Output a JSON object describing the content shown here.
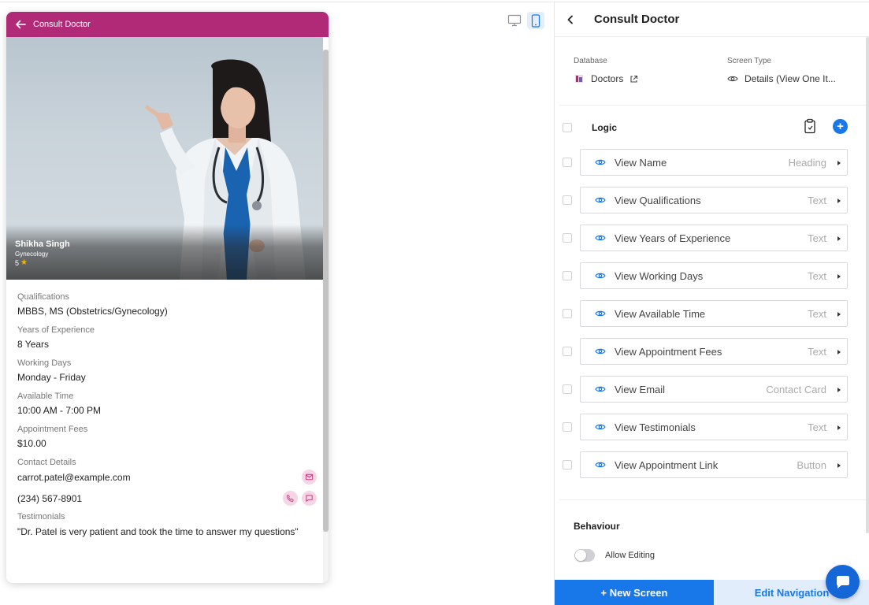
{
  "preview": {
    "header_title": "Consult Doctor",
    "doctor": {
      "name": "Shikha Singh",
      "specialty": "Gynecology",
      "rating": "5"
    },
    "fields": [
      {
        "label": "Qualifications",
        "value": "MBBS, MS (Obstetrics/Gynecology)"
      },
      {
        "label": "Years of Experience",
        "value": "8 Years"
      },
      {
        "label": "Working Days",
        "value": "Monday - Friday"
      },
      {
        "label": "Available Time",
        "value": "10:00 AM - 7:00 PM"
      },
      {
        "label": "Appointment Fees",
        "value": "$10.00"
      }
    ],
    "contact": {
      "label": "Contact Details",
      "email": "carrot.patel@example.com",
      "phone": "(234) 567-8901"
    },
    "testimonials": {
      "label": "Testimonials",
      "text": "\"Dr. Patel is very patient and took the time to answer my questions\""
    },
    "accent_color": "#b12a78"
  },
  "panel": {
    "title": "Consult Doctor",
    "database_label": "Database",
    "database_value": "Doctors",
    "screen_type_label": "Screen Type",
    "screen_type_value": "Details (View One It...",
    "logic_label": "Logic",
    "components": [
      {
        "name": "View Name",
        "type": "Heading"
      },
      {
        "name": "View Qualifications",
        "type": "Text"
      },
      {
        "name": "View Years of Experience",
        "type": "Text"
      },
      {
        "name": "View Working Days",
        "type": "Text"
      },
      {
        "name": "View Available Time",
        "type": "Text"
      },
      {
        "name": "View Appointment Fees",
        "type": "Text"
      },
      {
        "name": "View Email",
        "type": "Contact Card"
      },
      {
        "name": "View Testimonials",
        "type": "Text"
      },
      {
        "name": "View Appointment Link",
        "type": "Button"
      }
    ],
    "behaviour_label": "Behaviour",
    "allow_editing_label": "Allow Editing",
    "new_screen_label": "+ New Screen",
    "edit_navigation_label": "Edit Navigation",
    "primary_color": "#1877e9"
  }
}
